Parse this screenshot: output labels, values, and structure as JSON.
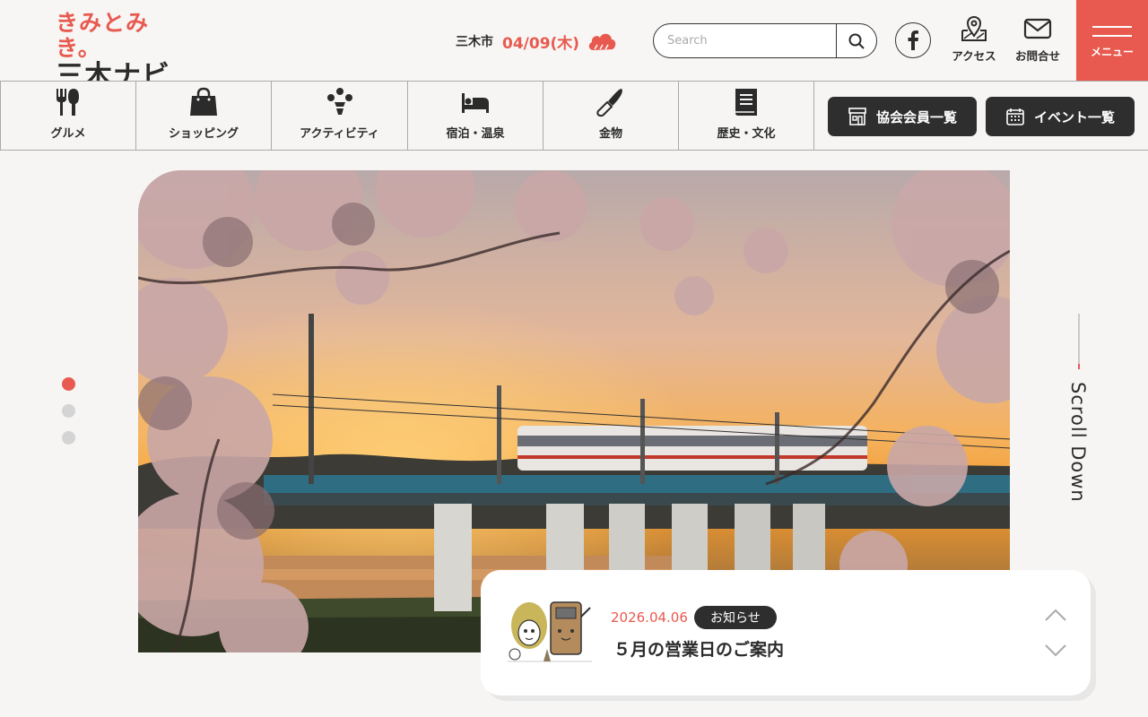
{
  "brand": {
    "logo_top": "きみとみき。",
    "logo_bottom": "三木ナビ",
    "accent": "#e85a4f",
    "dark": "#2e2e2e"
  },
  "weather": {
    "city": "三木市",
    "date": "04/09(木)",
    "icon": "cloud-icon"
  },
  "search": {
    "placeholder": "Search",
    "icon": "search-icon"
  },
  "header_links": {
    "facebook_icon": "facebook-icon",
    "access_label": "アクセス",
    "access_icon": "map-pin-icon",
    "contact_label": "お問合せ",
    "contact_icon": "envelope-icon",
    "menu_label": "メニュー"
  },
  "nav": {
    "items": [
      {
        "label": "グルメ",
        "icon": "fork-knife-icon"
      },
      {
        "label": "ショッピング",
        "icon": "shopping-bag-icon"
      },
      {
        "label": "アクティビティ",
        "icon": "activity-icon"
      },
      {
        "label": "宿泊・温泉",
        "icon": "bed-icon"
      },
      {
        "label": "金物",
        "icon": "blade-icon"
      },
      {
        "label": "歴史・文化",
        "icon": "book-icon"
      }
    ],
    "members_button": "協会会員一覧",
    "events_button": "イベント一覧"
  },
  "slider": {
    "active_index": 0,
    "dot_count": 3
  },
  "scroll_label": "Scroll Down",
  "news": {
    "date": "2026.04.06",
    "category": "お知らせ",
    "title": "５月の営業日のご案内"
  }
}
